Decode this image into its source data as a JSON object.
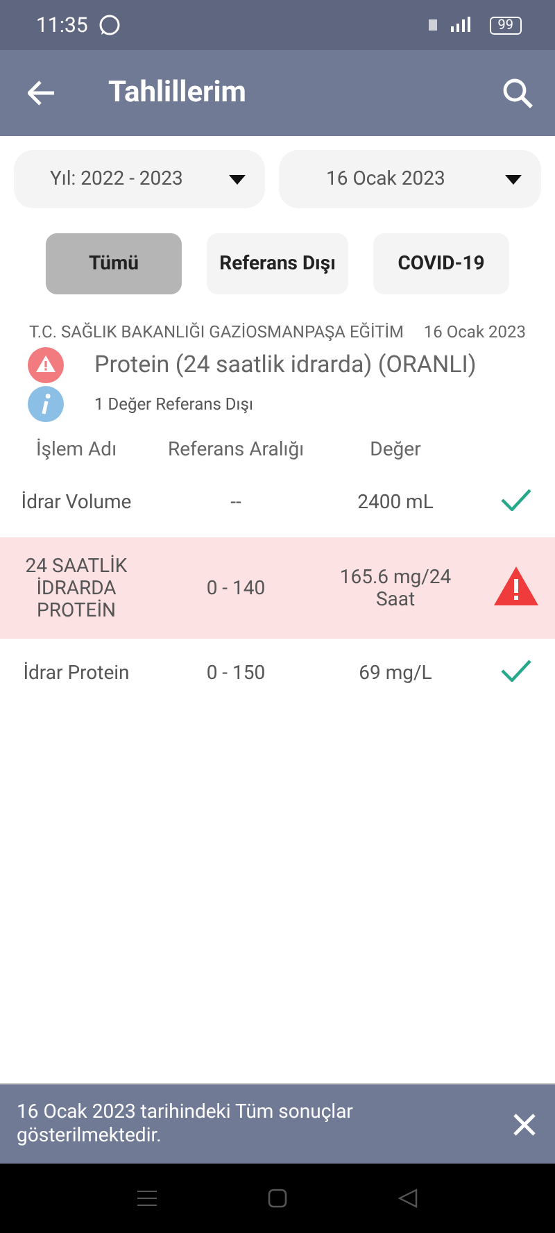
{
  "status_bar": {
    "time": "11:35",
    "battery": "99"
  },
  "app_bar": {
    "title": "Tahlillerim"
  },
  "dropdowns": [
    {
      "value": "Yıl: 2022 - 2023"
    },
    {
      "value": "16 Ocak 2023"
    }
  ],
  "filters": [
    {
      "label": "Tümü",
      "selected": true
    },
    {
      "label": "Referans Dışı",
      "selected": false
    },
    {
      "label": "COVID-19",
      "selected": false
    }
  ],
  "result": {
    "institution": "T.C. SAĞLIK BAKANLIĞI GAZİOSMANPAŞA EĞİTİM",
    "date": "16 Ocak 2023",
    "test_name": "Protein (24 saatlik idrarda) (ORANLI)",
    "summary": "1 Değer Referans Dışı"
  },
  "table": {
    "columns": [
      "İşlem Adı",
      "Referans Aralığı",
      "Değer"
    ],
    "rows": [
      {
        "name": "İdrar Volume",
        "range": "--",
        "value": "2400 mL",
        "out_of_range": false
      },
      {
        "name": "24 SAATLİK İDRARDA PROTEİN",
        "range": "0 - 140",
        "value": "165.6 mg/24 Saat",
        "out_of_range": true
      },
      {
        "name": "İdrar Protein",
        "range": "0 - 150",
        "value": "69 mg/L",
        "out_of_range": false
      }
    ]
  },
  "snackbar": {
    "message": "16 Ocak 2023 tarihindeki Tüm sonuçlar gösterilmektedir."
  }
}
